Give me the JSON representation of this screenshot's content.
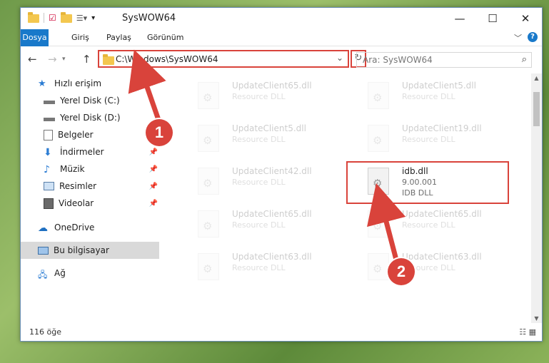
{
  "window": {
    "title": "SysWOW64",
    "minimize": "—",
    "maximize": "☐",
    "close": "✕"
  },
  "ribbon": {
    "tabs": [
      "Dosya",
      "Giriş",
      "Paylaş",
      "Görünüm"
    ],
    "help": "?"
  },
  "nav": {
    "back": "←",
    "forward": "→",
    "up": "↑",
    "address": "C:\\Windows\\SysWOW64",
    "search_placeholder": "Ara: SysWOW64"
  },
  "sidebar": {
    "items": [
      {
        "label": "Hızlı erişim",
        "icon": "star-icon"
      },
      {
        "label": "Yerel Disk (C:)",
        "icon": "drive-icon"
      },
      {
        "label": "Yerel Disk (D:)",
        "icon": "drive-icon"
      },
      {
        "label": "Belgeler",
        "icon": "document-icon"
      },
      {
        "label": "İndirmeler",
        "icon": "download-icon"
      },
      {
        "label": "Müzik",
        "icon": "music-icon"
      },
      {
        "label": "Resimler",
        "icon": "pictures-icon"
      },
      {
        "label": "Videolar",
        "icon": "video-icon"
      },
      {
        "label": "OneDrive",
        "icon": "cloud-icon"
      },
      {
        "label": "Bu bilgisayar",
        "icon": "computer-icon"
      },
      {
        "label": "Ağ",
        "icon": "network-icon"
      }
    ]
  },
  "files": [
    {
      "name": "UpdateClient65.dll",
      "sub": "Resource DLL"
    },
    {
      "name": "UpdateClient5.dll",
      "sub": "Resource DLL"
    },
    {
      "name": "UpdateClient5.dll",
      "sub": "Resource DLL"
    },
    {
      "name": "UpdateClient19.dll",
      "sub": "Resource DLL"
    },
    {
      "name": "UpdateClient42.dll",
      "sub": "Resource DLL"
    },
    {
      "name": "idb.dll",
      "version": "9.00.001",
      "sub": "IDB DLL"
    },
    {
      "name": "UpdateClient65.dll",
      "sub": "Resource DLL"
    },
    {
      "name": "UpdateClient65.dll",
      "sub": "Resource DLL"
    },
    {
      "name": "UpdateClient63.dll",
      "sub": "Resource DLL"
    },
    {
      "name": "UpdateClient63.dll",
      "sub": "Resource DLL"
    }
  ],
  "status": {
    "count": "116 öğe"
  },
  "annotations": {
    "badge1": "1",
    "badge2": "2"
  }
}
